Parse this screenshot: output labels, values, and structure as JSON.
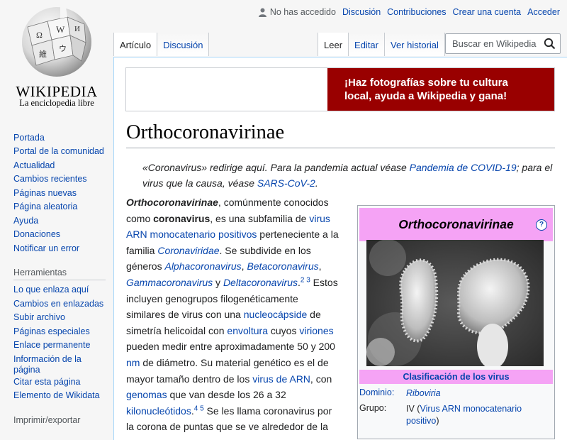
{
  "logo": {
    "wordmark": "WIKIPEDIA",
    "tagline": "La enciclopedia libre"
  },
  "personal": {
    "not_logged": "No has accedido",
    "links": [
      "Discusión",
      "Contribuciones",
      "Crear una cuenta",
      "Acceder"
    ]
  },
  "tabs": {
    "left": [
      "Artículo",
      "Discusión"
    ],
    "right": [
      "Leer",
      "Editar",
      "Ver historial"
    ]
  },
  "search": {
    "placeholder": "Buscar en Wikipedia"
  },
  "banner": {
    "line1": "¡Haz fotografías sobre tu cultura",
    "line2": "local, ayuda a Wikipedia y gana!"
  },
  "article": {
    "title": "Orthocoronavirinae",
    "hatnote": {
      "t1": "«Coronavirus» redirige aquí. Para la pandemia actual véase ",
      "l1": "Pandemia de COVID-19",
      "t2": "; para el virus que la causa, véase ",
      "l2": "SARS-CoV-2",
      "t3": "."
    },
    "p": {
      "b1": "Orthocoronavirinae",
      "t1": ", comúnmente conocidos como ",
      "b2": "coronavirus",
      "t2": ", es una subfamilia de ",
      "l1": "virus ARN monocatenario positivos",
      "t3": " perteneciente a la familia ",
      "l2": "Coronaviridae",
      "t4": ". Se subdivide en los géneros ",
      "l3": "Alphacoronavirus",
      "t5": ", ",
      "l4": "Betacoronavirus",
      "t6": ", ",
      "l5": "Gammacoronavirus",
      "t7": " y ",
      "l6": "Deltacoronavirus",
      "t8": ".",
      "s1": "2",
      "s2": "3",
      "t9": " Estos incluyen genogrupos filogenéticamente similares de virus con una ",
      "l7": "nucleocápside",
      "t10": " de simetría helicoidal con ",
      "l8": "envoltura",
      "t11": " cuyos ",
      "l9": "viriones",
      "t12": " pueden medir entre aproximadamente 50 y 200 ",
      "l10": "nm",
      "t13": " de diámetro. Su material genético es el de mayor tamaño dentro de los ",
      "l11": "virus de ARN",
      "t14": ", con ",
      "l12": "genomas",
      "t15": " que van desde los 26 a 32 ",
      "l13": "kilonucleótidos",
      "t16": ".",
      "s3": "4",
      "s4": "5",
      "t17": " Se les llama coronavirus por la corona de puntas que se ve alrededor de la"
    }
  },
  "infobox": {
    "title": "Orthocoronavirinae",
    "help": "?",
    "classification": "Clasificación de los virus",
    "rows": [
      {
        "key": "Dominio:",
        "value": "Riboviria"
      },
      {
        "key": "Grupo:",
        "value_prefix": "IV (",
        "value_link": "Virus ARN monocatenario positivo",
        "value_suffix": ")"
      }
    ]
  },
  "sidebar": {
    "nav": [
      "Portada",
      "Portal de la comunidad",
      "Actualidad",
      "Cambios recientes",
      "Páginas nuevas",
      "Página aleatoria",
      "Ayuda",
      "Donaciones",
      "Notificar un error"
    ],
    "tools_heading": "Herramientas",
    "tools": [
      "Lo que enlaza aquí",
      "Cambios en enlazadas",
      "Subir archivo",
      "Páginas especiales",
      "Enlace permanente",
      "Información de la página",
      "Citar esta página",
      "Elemento de Wikidata"
    ],
    "print_heading": "Imprimir/exportar"
  },
  "colors": {
    "link": "#0645ad",
    "infobox_header": "#f5a3f5",
    "banner_red": "#990000"
  }
}
